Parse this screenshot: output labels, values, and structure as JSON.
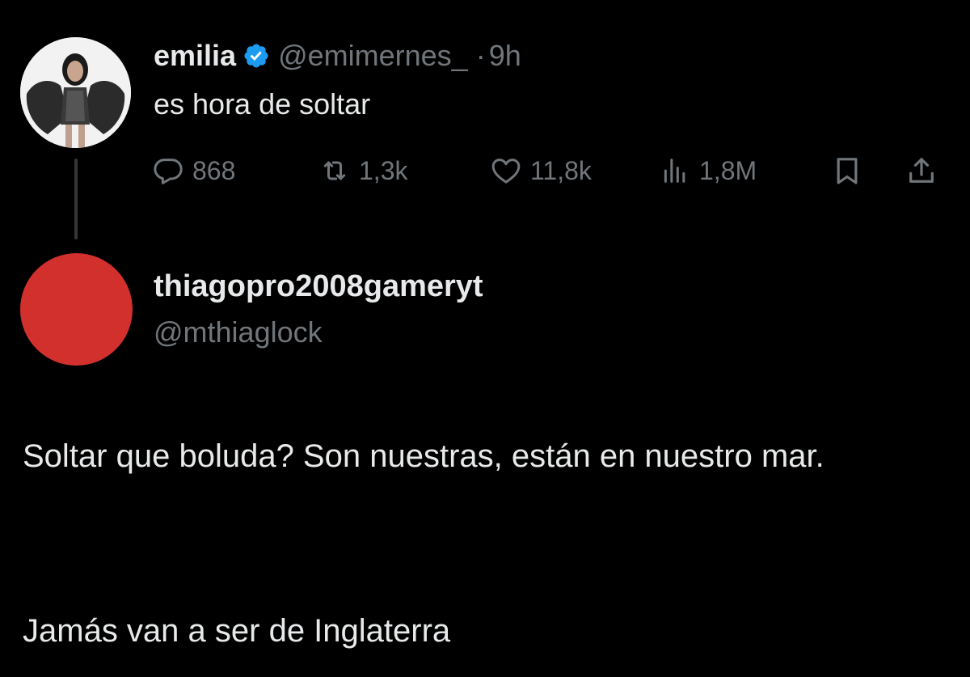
{
  "colors": {
    "background": "#000000",
    "primary_text": "#e7e9ea",
    "secondary_text": "#71767b",
    "verified_badge": "#1d9bf0",
    "reply_avatar": "#d2302c"
  },
  "original_tweet": {
    "author_name": "emilia",
    "verified": true,
    "verified_icon": "verified-badge-icon",
    "handle": "@emimernes_",
    "separator": "·",
    "time": "9h",
    "text": "es hora de soltar",
    "actions": {
      "replies": {
        "icon": "reply-icon",
        "count": "868"
      },
      "retweets": {
        "icon": "retweet-icon",
        "count": "1,3k"
      },
      "likes": {
        "icon": "heart-icon",
        "count": "11,8k"
      },
      "views": {
        "icon": "views-icon",
        "count": "1,8M"
      },
      "bookmark": {
        "icon": "bookmark-icon"
      },
      "share": {
        "icon": "share-icon"
      }
    }
  },
  "reply": {
    "author_name": "thiagopro2008gameryt",
    "handle": "@mthiaglock",
    "paragraph_1": "Soltar que boluda? Son nuestras, están en nuestro mar.",
    "paragraph_2": "Jamás van a ser de Inglaterra"
  }
}
